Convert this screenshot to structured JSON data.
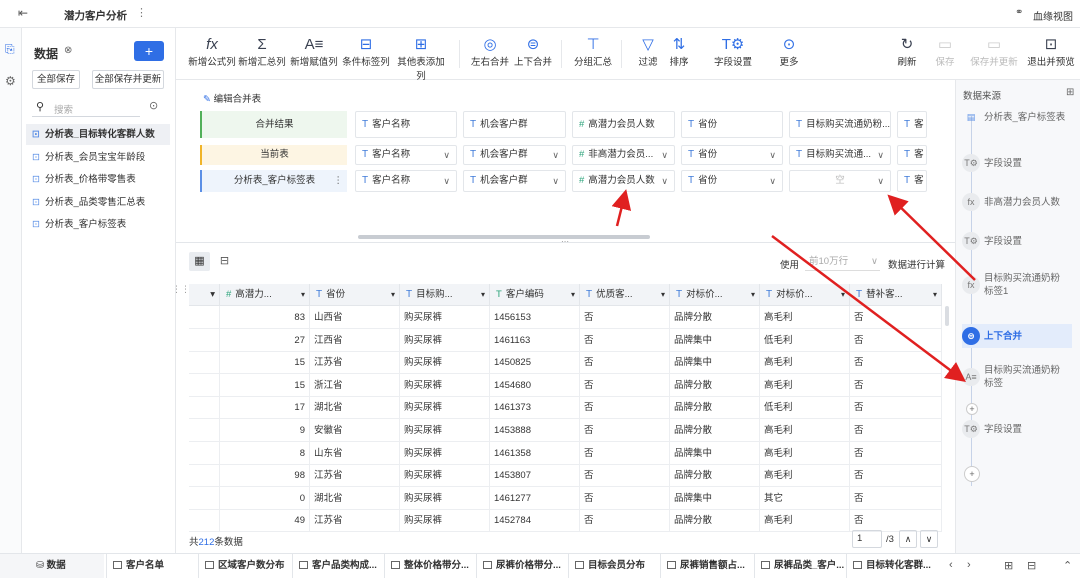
{
  "header": {
    "title": "潜力客户分析",
    "lineage": "血缘视图"
  },
  "left": {
    "title": "数据",
    "save_all": "全部保存",
    "save_all_update": "全部保存并更新",
    "search_placeholder": "搜索",
    "items": [
      "分析表_目标转化客群人数",
      "分析表_会员宝宝年龄段",
      "分析表_价格带零售表",
      "分析表_品类零售汇总表",
      "分析表_客户标签表"
    ]
  },
  "toolbar": {
    "buttons": [
      "新增公式列",
      "新增汇总列",
      "新增赋值列",
      "条件标签列",
      "其他表添加列",
      "左右合并",
      "上下合并",
      "分组汇总",
      "过滤",
      "排序",
      "字段设置",
      "更多"
    ],
    "right": [
      "刷新",
      "保存",
      "保存并更新",
      "退出并预览"
    ]
  },
  "merge": {
    "edit": "编辑合并表",
    "row_labels": [
      "合并结果",
      "当前表",
      "分析表_客户标签表"
    ],
    "cols": [
      "客户名称",
      "机会客户群",
      "高潜力会员人数",
      "省份",
      "目标购买流通奶粉...",
      "客"
    ],
    "current": [
      "客户名称",
      "机会客户群",
      "非高潜力会员...",
      "省份",
      "目标购买流通...",
      "客"
    ],
    "source": [
      "客户名称",
      "机会客户群",
      "高潜力会员人数",
      "省份",
      "空",
      "客"
    ]
  },
  "view": {
    "use": "使用",
    "sample": "前10万行",
    "compute": "数据进行计算"
  },
  "grid": {
    "headers": [
      "高潜力...",
      "省份",
      "目标购...",
      "客户编码",
      "优质客...",
      "对标价...",
      "对标价...",
      "替补客..."
    ],
    "rows": [
      [
        "83",
        "山西省",
        "购买尿裤",
        "1456153",
        "否",
        "品牌分散",
        "高毛利",
        "否"
      ],
      [
        "27",
        "江西省",
        "购买尿裤",
        "1461163",
        "否",
        "品牌集中",
        "低毛利",
        "否"
      ],
      [
        "15",
        "江苏省",
        "购买尿裤",
        "1450825",
        "否",
        "品牌集中",
        "高毛利",
        "否"
      ],
      [
        "15",
        "浙江省",
        "购买尿裤",
        "1454680",
        "否",
        "品牌分散",
        "高毛利",
        "否"
      ],
      [
        "17",
        "湖北省",
        "购买尿裤",
        "1461373",
        "否",
        "品牌分散",
        "低毛利",
        "否"
      ],
      [
        "9",
        "安徽省",
        "购买尿裤",
        "1453888",
        "否",
        "品牌分散",
        "高毛利",
        "否"
      ],
      [
        "8",
        "山东省",
        "购买尿裤",
        "1461358",
        "否",
        "品牌集中",
        "高毛利",
        "否"
      ],
      [
        "98",
        "江苏省",
        "购买尿裤",
        "1453807",
        "否",
        "品牌分散",
        "高毛利",
        "否"
      ],
      [
        "0",
        "湖北省",
        "购买尿裤",
        "1461277",
        "否",
        "品牌集中",
        "其它",
        "否"
      ],
      [
        "49",
        "江苏省",
        "购买尿裤",
        "1452784",
        "否",
        "品牌分散",
        "高毛利",
        "否"
      ]
    ],
    "total_prefix": "共",
    "total": "212",
    "total_suffix": "条数据",
    "page": "1",
    "pages": "/3"
  },
  "right": {
    "title": "数据来源",
    "steps": [
      "分析表_客户标签表",
      "字段设置",
      "非高潜力会员人数",
      "字段设置",
      "目标购买流通奶粉标签1",
      "上下合并",
      "目标购买流通奶粉标签",
      "字段设置"
    ]
  },
  "bottom": {
    "data_tab": "数据",
    "tabs": [
      "客户名单",
      "区域客户数分布",
      "客户品类构成...",
      "整体价格带分...",
      "尿裤价格带分...",
      "目标会员分布",
      "尿裤销售额占...",
      "尿裤品类_客户...",
      "目标转化客群..."
    ]
  },
  "colors": {
    "accent": "#2f6ee5",
    "arrow": "#e02020"
  }
}
